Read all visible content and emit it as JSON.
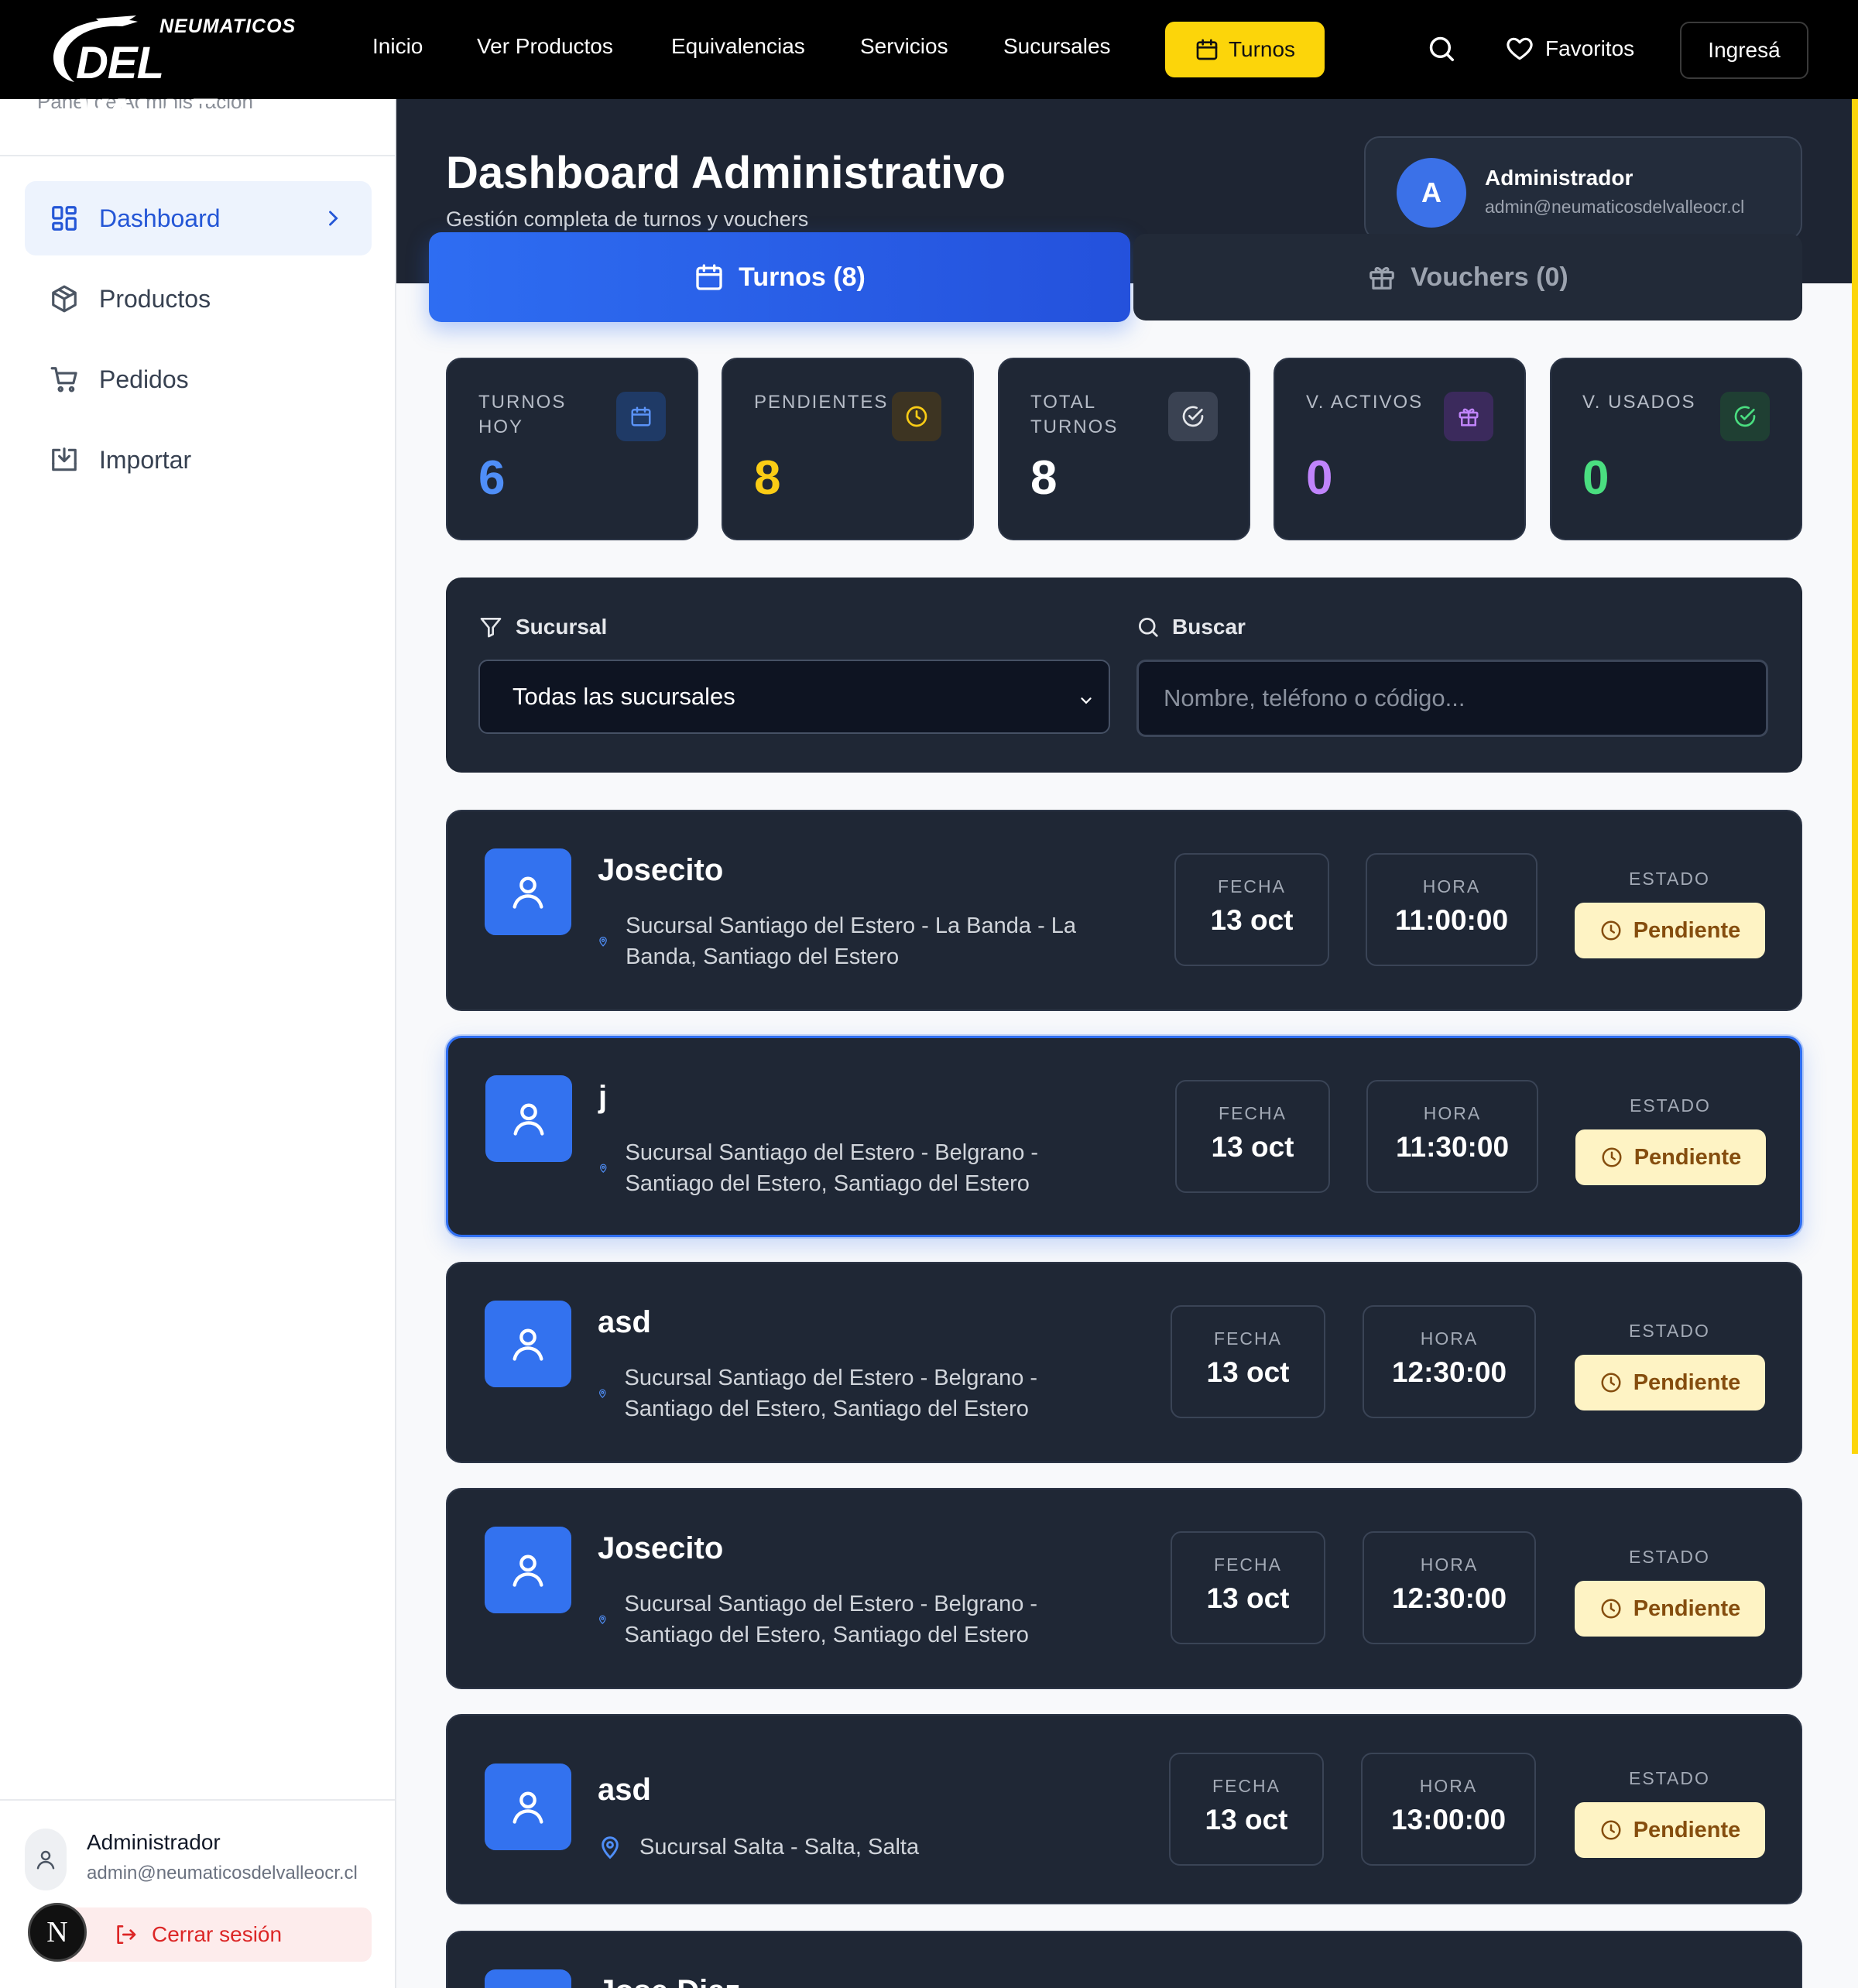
{
  "brand": {
    "logo_small": "NEUMATICOS",
    "logo_big": "DEL VALLE"
  },
  "nav": {
    "items": [
      "Inicio",
      "Ver Productos",
      "Equivalencias",
      "Servicios",
      "Sucursales"
    ],
    "turnos_label": "Turnos",
    "favoritos_label": "Favoritos",
    "login_label": "Ingresá"
  },
  "sidebar": {
    "panel_title": "Panel de Administración",
    "items": [
      {
        "label": "Dashboard",
        "icon": "dashboard-grid-icon",
        "active": true
      },
      {
        "label": "Productos",
        "icon": "package-icon"
      },
      {
        "label": "Pedidos",
        "icon": "cart-icon"
      },
      {
        "label": "Importar",
        "icon": "import-icon"
      }
    ],
    "user_name": "Administrador",
    "user_email": "admin@neumaticosdelvalleocr.cl",
    "logout_label": "Cerrar sesión",
    "dev_badge": "N"
  },
  "header": {
    "title": "Dashboard Administrativo",
    "subtitle": "Gestión completa de turnos y vouchers",
    "admin_initial": "A",
    "admin_name": "Administrador",
    "admin_email": "admin@neumaticosdelvalleocr.cl"
  },
  "tabs": [
    {
      "label": "Turnos (8)",
      "active": true
    },
    {
      "label": "Vouchers (0)",
      "active": false
    }
  ],
  "stats": [
    {
      "label": "TURNOS HOY",
      "value": "6",
      "color": "#4f8ef7",
      "icon": "calendar-icon"
    },
    {
      "label": "PENDIENTES",
      "value": "8",
      "color": "#facc15",
      "icon": "clock-icon"
    },
    {
      "label": "TOTAL TURNOS",
      "value": "8",
      "color": "#ffffff",
      "icon": "check-circle-icon"
    },
    {
      "label": "V. ACTIVOS",
      "value": "0",
      "color": "#c084fc",
      "icon": "gift-icon"
    },
    {
      "label": "V. USADOS",
      "value": "0",
      "color": "#4ade80",
      "icon": "check-circle-icon"
    }
  ],
  "filters": {
    "sucursal_label": "Sucursal",
    "sucursal_value": "Todas las sucursales",
    "buscar_label": "Buscar",
    "buscar_placeholder": "Nombre, teléfono o código..."
  },
  "turnos_labels": {
    "fecha": "FECHA",
    "hora": "HORA",
    "estado": "ESTADO"
  },
  "turnos": [
    {
      "name": "Josecito",
      "location": "Sucursal Santiago del Estero - La Banda - La Banda, Santiago del Estero",
      "fecha": "13 oct",
      "hora": "11:00:00",
      "estado": "Pendiente"
    },
    {
      "name": "j",
      "location": "Sucursal Santiago del Estero - Belgrano - Santiago del Estero, Santiago del Estero",
      "fecha": "13 oct",
      "hora": "11:30:00",
      "estado": "Pendiente",
      "selected": true
    },
    {
      "name": "asd",
      "location": "Sucursal Santiago del Estero - Belgrano - Santiago del Estero, Santiago del Estero",
      "fecha": "13 oct",
      "hora": "12:30:00",
      "estado": "Pendiente"
    },
    {
      "name": "Josecito",
      "location": "Sucursal Santiago del Estero - Belgrano - Santiago del Estero, Santiago del Estero",
      "fecha": "13 oct",
      "hora": "12:30:00",
      "estado": "Pendiente"
    },
    {
      "name": "asd",
      "location": "Sucursal Salta - Salta, Salta",
      "fecha": "13 oct",
      "hora": "13:00:00",
      "estado": "Pendiente"
    },
    {
      "name": "Jose Diaz"
    }
  ]
}
